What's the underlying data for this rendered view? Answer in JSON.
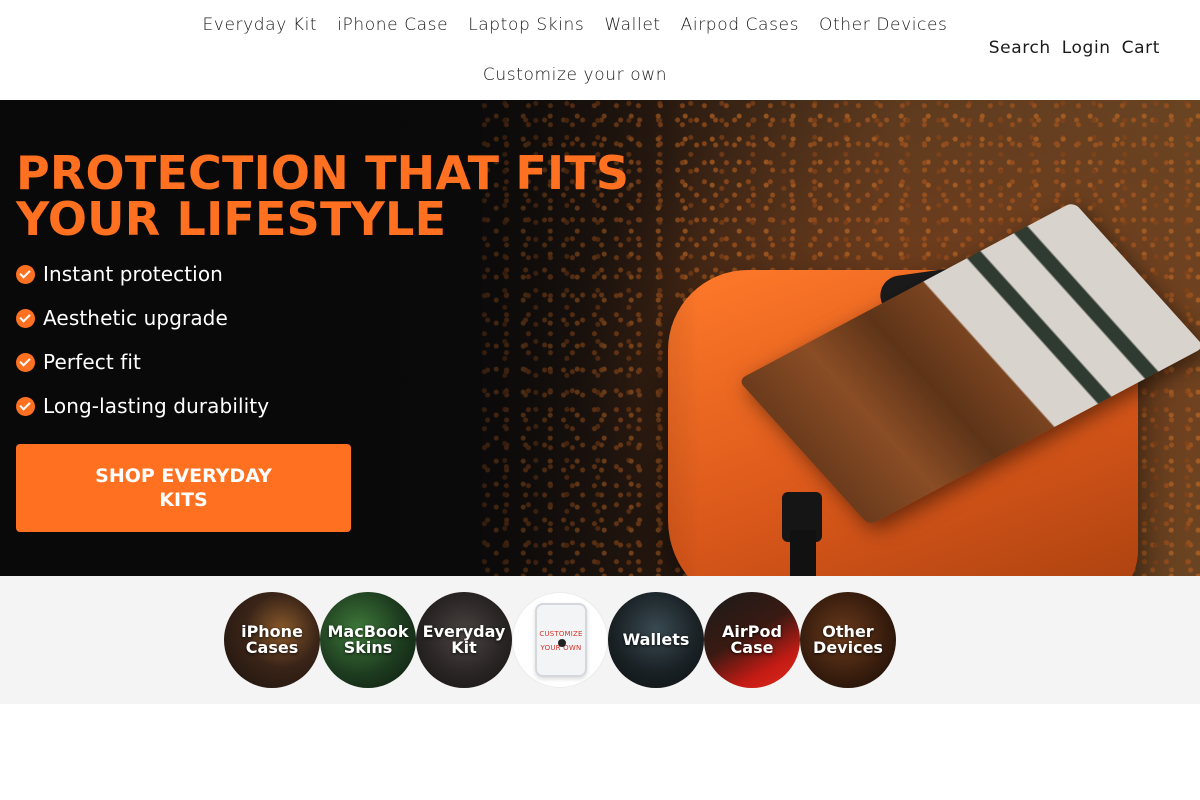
{
  "nav": {
    "links": [
      "Everyday Kit",
      "iPhone Case",
      "Laptop Skins",
      "Wallet",
      "Airpod Cases",
      "Other Devices"
    ],
    "link_row2": "Customize your own",
    "actions": {
      "search": "Search",
      "login": "Login",
      "cart": "Cart"
    }
  },
  "hero": {
    "title_line1": "PROTECTION THAT FITS",
    "title_line2": "YOUR LIFESTYLE",
    "benefits": [
      "Instant protection",
      "Aesthetic upgrade",
      "Perfect fit",
      "Long-lasting durability"
    ],
    "cta_label": "SHOP EVERYDAY KITS",
    "accent_color": "#ff7020"
  },
  "categories": [
    {
      "label": "iPhone Cases"
    },
    {
      "label": "MacBook Skins"
    },
    {
      "label": "Everyday Kit"
    },
    {
      "label": "",
      "image_text": "CUSTOMIZE YOUR OWN"
    },
    {
      "label": "Wallets"
    },
    {
      "label": "AirPod Case"
    },
    {
      "label": "Other Devices"
    }
  ]
}
